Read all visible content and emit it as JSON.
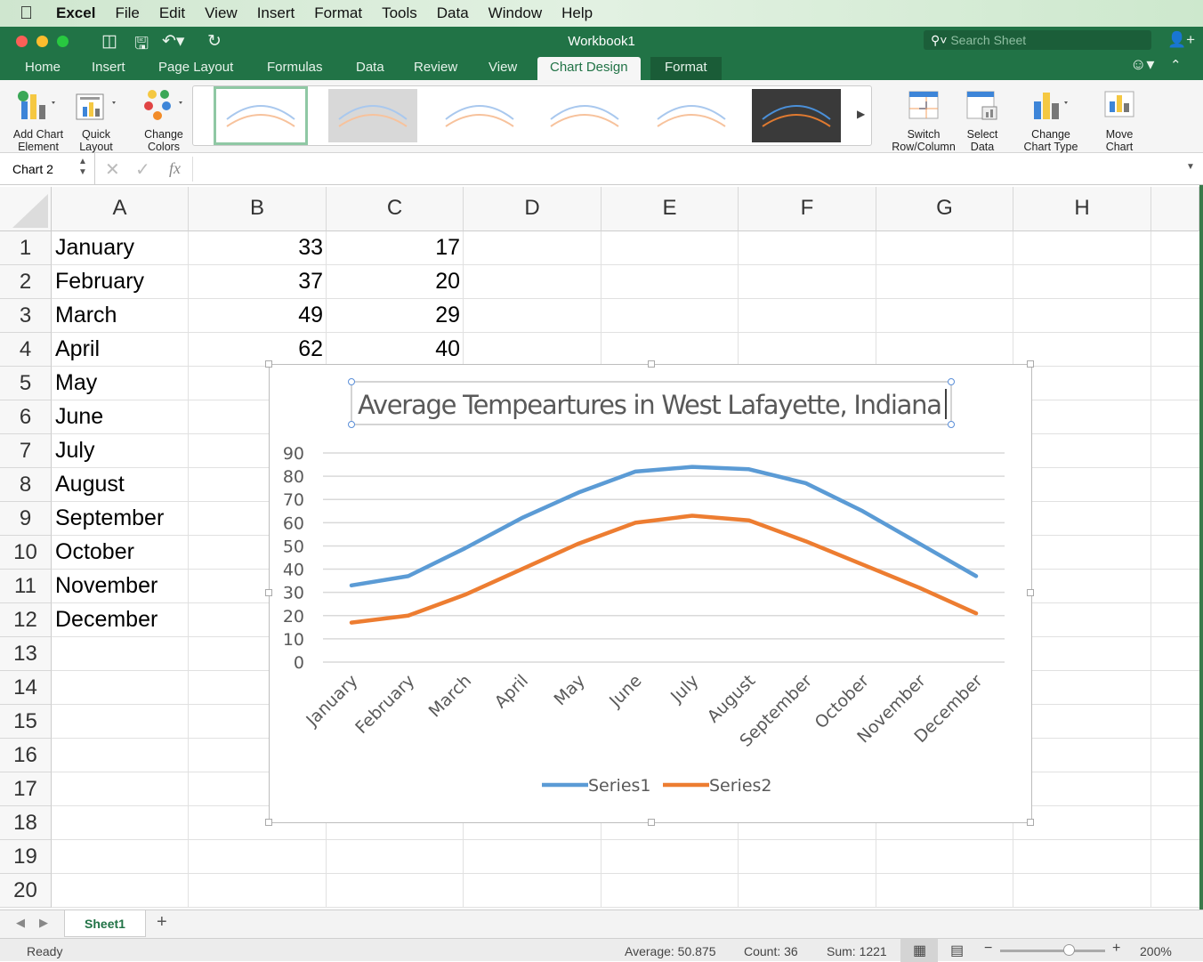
{
  "menubar": {
    "items": [
      "Excel",
      "File",
      "Edit",
      "View",
      "Insert",
      "Format",
      "Tools",
      "Data",
      "Window",
      "Help"
    ]
  },
  "window": {
    "title": "Workbook1",
    "search_placeholder": "Search Sheet"
  },
  "tabs": [
    "Home",
    "Insert",
    "Page Layout",
    "Formulas",
    "Data",
    "Review",
    "View",
    "Chart Design",
    "Format"
  ],
  "active_tab": "Chart Design",
  "ribbon": {
    "add_chart_element": [
      "Add Chart",
      "Element"
    ],
    "quick_layout": [
      "Quick",
      "Layout"
    ],
    "change_colors": [
      "Change",
      "Colors"
    ],
    "switch": [
      "Switch",
      "Row/Column"
    ],
    "select_data": [
      "Select",
      "Data"
    ],
    "change_type": [
      "Change",
      "Chart Type"
    ],
    "move_chart": [
      "Move",
      "Chart"
    ]
  },
  "formula_bar": {
    "name_box": "Chart 2",
    "fx": "fx",
    "value": ""
  },
  "columns": [
    "A",
    "B",
    "C",
    "D",
    "E",
    "F",
    "G",
    "H"
  ],
  "rows": [
    "1",
    "2",
    "3",
    "4",
    "5",
    "6",
    "7",
    "8",
    "9",
    "10",
    "11",
    "12",
    "13",
    "14",
    "15",
    "16",
    "17",
    "18",
    "19",
    "20"
  ],
  "cells": {
    "A": [
      "January",
      "February",
      "March",
      "April",
      "May",
      "June",
      "July",
      "August",
      "September",
      "October",
      "November",
      "December"
    ],
    "B": [
      "33",
      "37",
      "49",
      "62"
    ],
    "C": [
      "17",
      "20",
      "29",
      "40"
    ]
  },
  "chart_data": {
    "type": "line",
    "title": "Average Tempeartures in West Lafayette, Indiana",
    "categories": [
      "January",
      "February",
      "March",
      "April",
      "May",
      "June",
      "July",
      "August",
      "September",
      "October",
      "November",
      "December"
    ],
    "series": [
      {
        "name": "Series1",
        "color": "#5b9bd5",
        "values": [
          33,
          37,
          49,
          62,
          73,
          82,
          84,
          83,
          77,
          65,
          51,
          37
        ]
      },
      {
        "name": "Series2",
        "color": "#ed7d31",
        "values": [
          17,
          20,
          29,
          40,
          51,
          60,
          63,
          61,
          52,
          42,
          32,
          21
        ]
      }
    ],
    "ylim": [
      0,
      90
    ],
    "yticks": [
      "0",
      "10",
      "20",
      "30",
      "40",
      "50",
      "60",
      "70",
      "80",
      "90"
    ],
    "grid": true,
    "legend": "bottom"
  },
  "sheets": {
    "tabs": [
      "Sheet1"
    ],
    "add": "+"
  },
  "status": {
    "ready": "Ready",
    "average": "Average: 50.875",
    "count": "Count: 36",
    "sum": "Sum: 1221",
    "zoom": "200%"
  }
}
